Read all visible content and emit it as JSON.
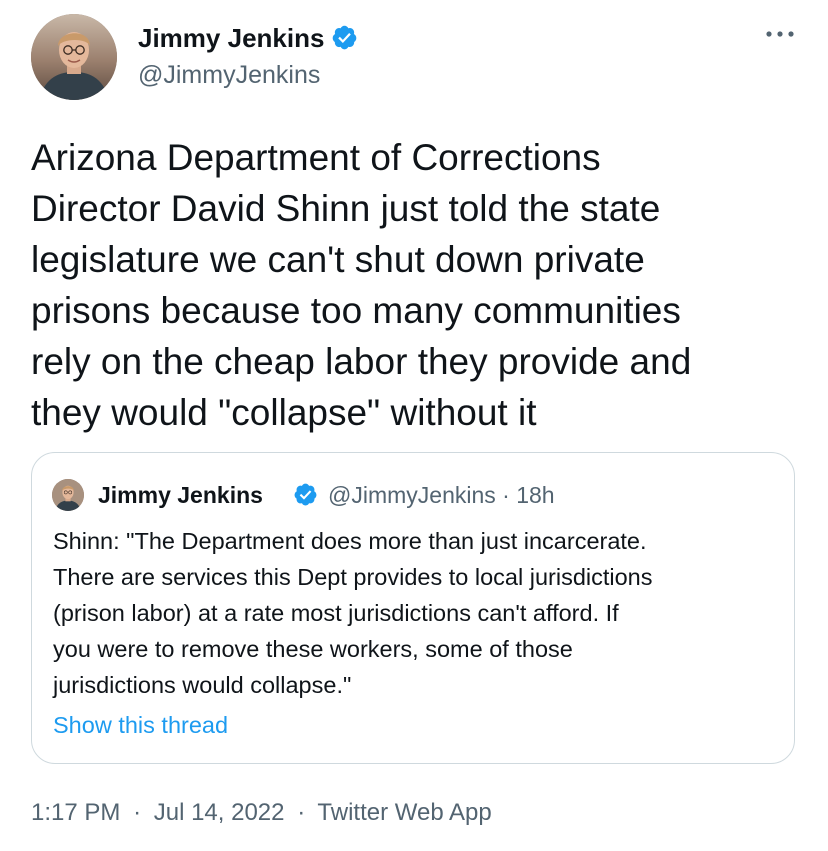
{
  "author": {
    "name": "Jimmy Jenkins",
    "handle": "@JimmyJenkins",
    "verified": true
  },
  "tweet": {
    "lines": [
      "Arizona Department of Corrections",
      "Director David Shinn just told the state",
      "legislature we can't shut down private",
      "prisons because too many communities",
      "rely on the cheap labor they provide and",
      "they would \"collapse\" without it"
    ]
  },
  "quote": {
    "name": "Jimmy Jenkins",
    "handle_time": "@JimmyJenkins · 18h",
    "lines": [
      "Shinn: \"The Department does more than just incarcerate.",
      "There are services this Dept provides to local jurisdictions",
      "(prison labor) at a rate most jurisdictions can't afford. If",
      "you were to remove these workers, some of those",
      "jurisdictions would collapse.\""
    ],
    "thread_link": "Show this thread"
  },
  "meta": {
    "time": "1:17 PM",
    "date": "Jul 14, 2022",
    "separator": "·",
    "source": "Twitter Web App"
  },
  "colors": {
    "text": "#0f1419",
    "secondary": "#536471",
    "accent": "#1d9bf0",
    "border": "#cfd9de"
  },
  "icons": {
    "verified": "verified-badge-icon",
    "more": "more-options-icon"
  }
}
